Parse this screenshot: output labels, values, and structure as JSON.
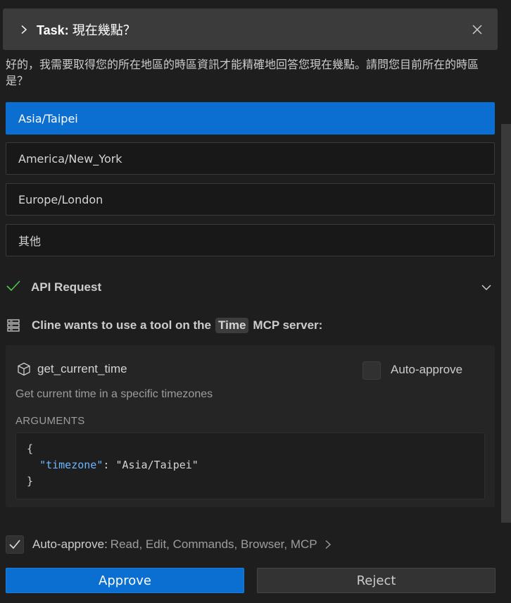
{
  "task": {
    "prefix": "Task:",
    "text": "現在幾點？"
  },
  "question": "好的，我需要取得您的所在地區的時區資訊才能精確地回答您現在幾點。請問您目前所在的時區是？",
  "options": [
    {
      "label": "Asia/Taipei",
      "selected": true
    },
    {
      "label": "America/New_York",
      "selected": false
    },
    {
      "label": "Europe/London",
      "selected": false
    },
    {
      "label": "其他",
      "selected": false
    }
  ],
  "api_request": {
    "label": "API Request"
  },
  "mcp": {
    "prefix": "Cline wants to use a tool on the",
    "server": "Time",
    "suffix": "MCP server:"
  },
  "tool": {
    "name": "get_current_time",
    "auto_approve_label": "Auto-approve",
    "description": "Get current time in a specific timezones",
    "arguments_title": "ARGUMENTS",
    "code_open": "{",
    "arg_key": "\"timezone\"",
    "arg_sep": ": ",
    "arg_value": "\"Asia/Taipei\"",
    "code_close": "}"
  },
  "auto_approve": {
    "label": "Auto-approve:",
    "items": "Read, Edit, Commands, Browser, MCP"
  },
  "buttons": {
    "approve": "Approve",
    "reject": "Reject"
  },
  "colors": {
    "accent": "#0b6fd1",
    "success": "#4ec94e",
    "code_key": "#6cb6ff"
  }
}
